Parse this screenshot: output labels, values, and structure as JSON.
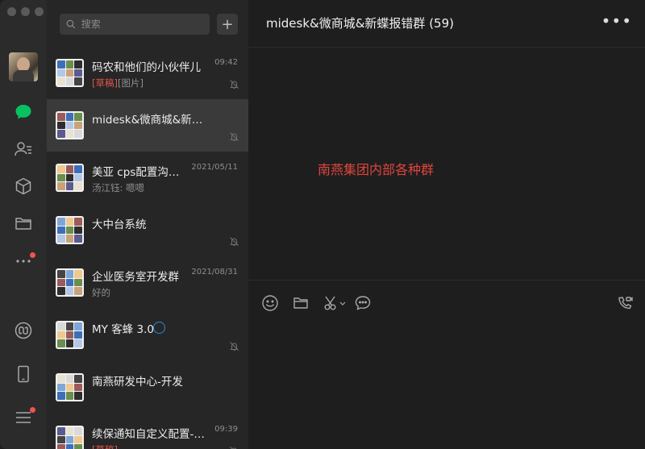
{
  "search": {
    "placeholder": "搜索"
  },
  "chat": {
    "title": "midesk&微商城&新蝶报错群 (59)",
    "center_text": "南燕集团内部各种群"
  },
  "conversations": [
    {
      "name": "码农和他们的小伙伴儿",
      "time": "09:42",
      "draft": "[草稿]",
      "preview": "[图片]",
      "muted": true
    },
    {
      "name": "midesk&微商城&新蝶报错群",
      "time": "",
      "draft": "",
      "preview": "",
      "muted": true,
      "active": true
    },
    {
      "name": "美亚 cps配置沟…",
      "time": "2021/05/11",
      "draft": "",
      "preview": "汤江钰: 嗯嗯",
      "muted": false
    },
    {
      "name": "大中台系统",
      "time": "",
      "draft": "",
      "preview": "",
      "muted": true
    },
    {
      "name": "企业医务室开发群",
      "time": "2021/08/31",
      "draft": "",
      "preview": "好的",
      "muted": false
    },
    {
      "name": "MY 客蜂 3.0",
      "time": "",
      "draft": "",
      "preview": "",
      "muted": true
    },
    {
      "name": "南燕研发中心-开发",
      "time": "",
      "draft": "",
      "preview": "",
      "muted": false
    },
    {
      "name": "续保通知自定义配置-…",
      "time": "09:39",
      "draft": "[草稿]",
      "preview": "",
      "muted": true
    }
  ],
  "icons": {
    "rail": [
      "chat-icon",
      "contacts-icon",
      "cube-icon",
      "folder-icon",
      "more-icon",
      "miniprogram-icon",
      "phone-icon",
      "menu-icon"
    ],
    "composer": [
      "emoji-icon",
      "folder-icon",
      "scissors-icon",
      "chat-bubble-icon",
      "video-call-icon"
    ]
  },
  "colors": {
    "accent_green": "#07c160",
    "draft_red": "#e0534d",
    "badge_red": "#f2534d",
    "center_text": "#e0453d"
  }
}
